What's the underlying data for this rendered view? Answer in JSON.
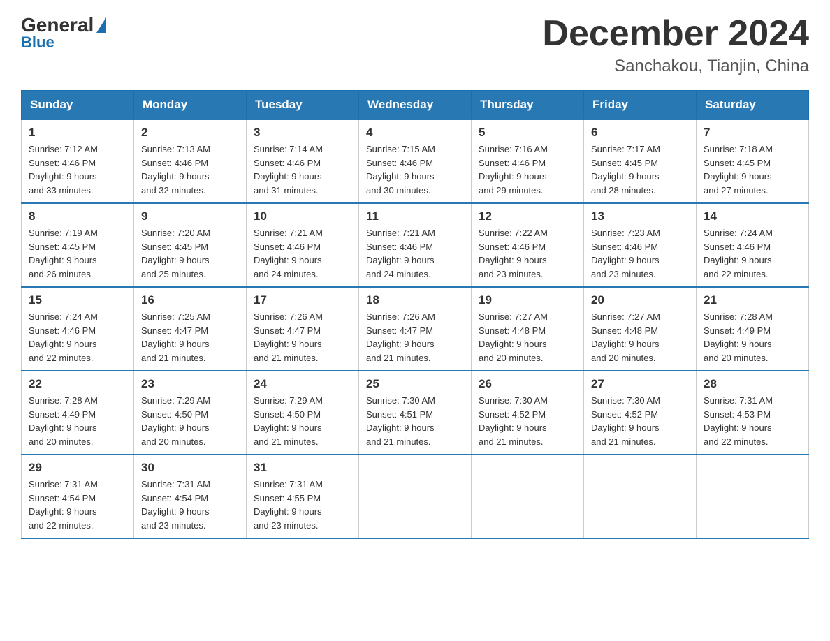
{
  "logo": {
    "general": "General",
    "blue": "Blue"
  },
  "header": {
    "month": "December 2024",
    "location": "Sanchakou, Tianjin, China"
  },
  "weekdays": [
    "Sunday",
    "Monday",
    "Tuesday",
    "Wednesday",
    "Thursday",
    "Friday",
    "Saturday"
  ],
  "weeks": [
    [
      {
        "day": "1",
        "sunrise": "7:12 AM",
        "sunset": "4:46 PM",
        "daylight": "9 hours and 33 minutes."
      },
      {
        "day": "2",
        "sunrise": "7:13 AM",
        "sunset": "4:46 PM",
        "daylight": "9 hours and 32 minutes."
      },
      {
        "day": "3",
        "sunrise": "7:14 AM",
        "sunset": "4:46 PM",
        "daylight": "9 hours and 31 minutes."
      },
      {
        "day": "4",
        "sunrise": "7:15 AM",
        "sunset": "4:46 PM",
        "daylight": "9 hours and 30 minutes."
      },
      {
        "day": "5",
        "sunrise": "7:16 AM",
        "sunset": "4:46 PM",
        "daylight": "9 hours and 29 minutes."
      },
      {
        "day": "6",
        "sunrise": "7:17 AM",
        "sunset": "4:45 PM",
        "daylight": "9 hours and 28 minutes."
      },
      {
        "day": "7",
        "sunrise": "7:18 AM",
        "sunset": "4:45 PM",
        "daylight": "9 hours and 27 minutes."
      }
    ],
    [
      {
        "day": "8",
        "sunrise": "7:19 AM",
        "sunset": "4:45 PM",
        "daylight": "9 hours and 26 minutes."
      },
      {
        "day": "9",
        "sunrise": "7:20 AM",
        "sunset": "4:45 PM",
        "daylight": "9 hours and 25 minutes."
      },
      {
        "day": "10",
        "sunrise": "7:21 AM",
        "sunset": "4:46 PM",
        "daylight": "9 hours and 24 minutes."
      },
      {
        "day": "11",
        "sunrise": "7:21 AM",
        "sunset": "4:46 PM",
        "daylight": "9 hours and 24 minutes."
      },
      {
        "day": "12",
        "sunrise": "7:22 AM",
        "sunset": "4:46 PM",
        "daylight": "9 hours and 23 minutes."
      },
      {
        "day": "13",
        "sunrise": "7:23 AM",
        "sunset": "4:46 PM",
        "daylight": "9 hours and 23 minutes."
      },
      {
        "day": "14",
        "sunrise": "7:24 AM",
        "sunset": "4:46 PM",
        "daylight": "9 hours and 22 minutes."
      }
    ],
    [
      {
        "day": "15",
        "sunrise": "7:24 AM",
        "sunset": "4:46 PM",
        "daylight": "9 hours and 22 minutes."
      },
      {
        "day": "16",
        "sunrise": "7:25 AM",
        "sunset": "4:47 PM",
        "daylight": "9 hours and 21 minutes."
      },
      {
        "day": "17",
        "sunrise": "7:26 AM",
        "sunset": "4:47 PM",
        "daylight": "9 hours and 21 minutes."
      },
      {
        "day": "18",
        "sunrise": "7:26 AM",
        "sunset": "4:47 PM",
        "daylight": "9 hours and 21 minutes."
      },
      {
        "day": "19",
        "sunrise": "7:27 AM",
        "sunset": "4:48 PM",
        "daylight": "9 hours and 20 minutes."
      },
      {
        "day": "20",
        "sunrise": "7:27 AM",
        "sunset": "4:48 PM",
        "daylight": "9 hours and 20 minutes."
      },
      {
        "day": "21",
        "sunrise": "7:28 AM",
        "sunset": "4:49 PM",
        "daylight": "9 hours and 20 minutes."
      }
    ],
    [
      {
        "day": "22",
        "sunrise": "7:28 AM",
        "sunset": "4:49 PM",
        "daylight": "9 hours and 20 minutes."
      },
      {
        "day": "23",
        "sunrise": "7:29 AM",
        "sunset": "4:50 PM",
        "daylight": "9 hours and 20 minutes."
      },
      {
        "day": "24",
        "sunrise": "7:29 AM",
        "sunset": "4:50 PM",
        "daylight": "9 hours and 21 minutes."
      },
      {
        "day": "25",
        "sunrise": "7:30 AM",
        "sunset": "4:51 PM",
        "daylight": "9 hours and 21 minutes."
      },
      {
        "day": "26",
        "sunrise": "7:30 AM",
        "sunset": "4:52 PM",
        "daylight": "9 hours and 21 minutes."
      },
      {
        "day": "27",
        "sunrise": "7:30 AM",
        "sunset": "4:52 PM",
        "daylight": "9 hours and 21 minutes."
      },
      {
        "day": "28",
        "sunrise": "7:31 AM",
        "sunset": "4:53 PM",
        "daylight": "9 hours and 22 minutes."
      }
    ],
    [
      {
        "day": "29",
        "sunrise": "7:31 AM",
        "sunset": "4:54 PM",
        "daylight": "9 hours and 22 minutes."
      },
      {
        "day": "30",
        "sunrise": "7:31 AM",
        "sunset": "4:54 PM",
        "daylight": "9 hours and 23 minutes."
      },
      {
        "day": "31",
        "sunrise": "7:31 AM",
        "sunset": "4:55 PM",
        "daylight": "9 hours and 23 minutes."
      },
      null,
      null,
      null,
      null
    ]
  ],
  "labels": {
    "sunrise": "Sunrise:",
    "sunset": "Sunset:",
    "daylight": "Daylight:"
  }
}
